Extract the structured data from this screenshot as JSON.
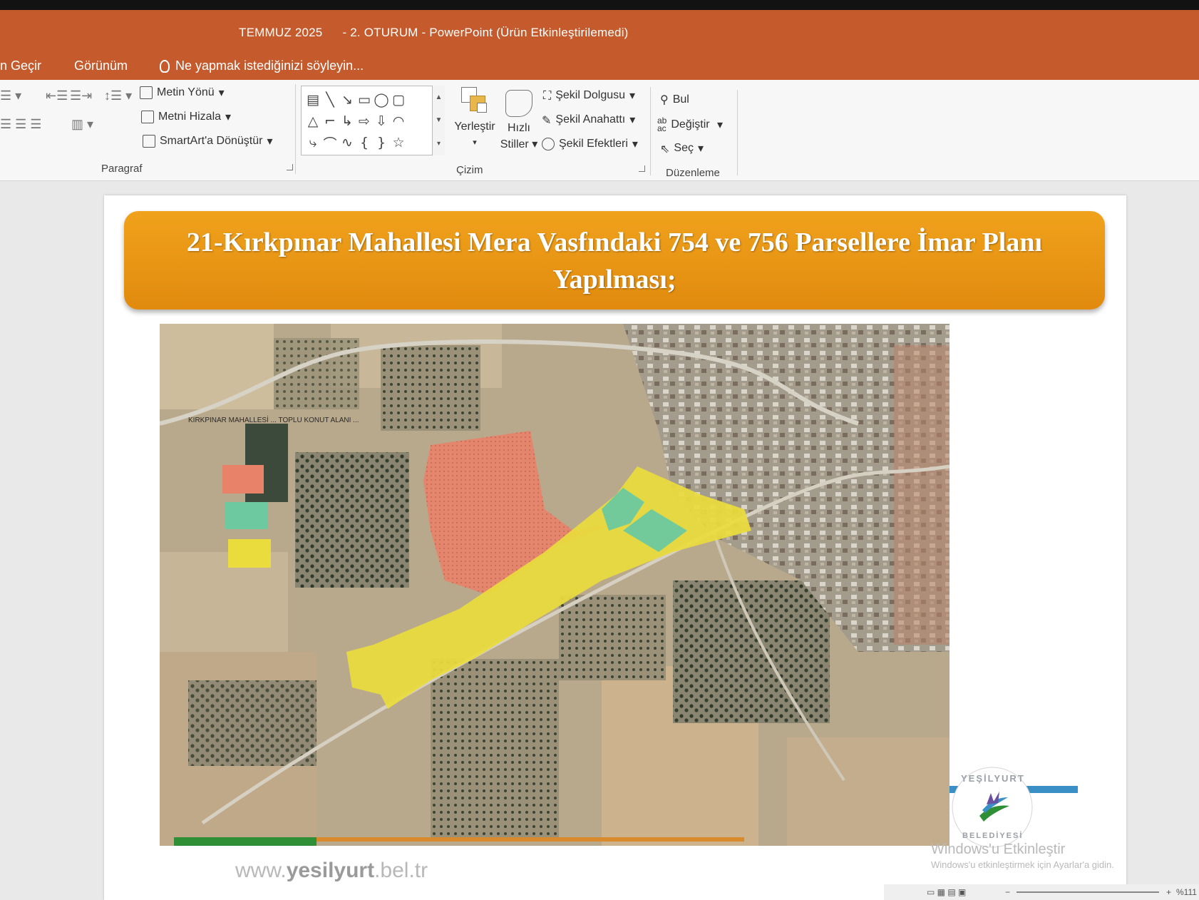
{
  "window": {
    "doc_part1": "TEMMUZ 2025",
    "doc_part2": "- 2. OTURUM - PowerPoint (Ürün Etkinleştirilemedi)"
  },
  "tabs": {
    "partial": "n Geçir",
    "view": "Görünüm",
    "tell_me": "Ne yapmak istediğinizi söyleyin..."
  },
  "ribbon": {
    "paragraph": {
      "label": "Paragraf",
      "text_direction": "Metin Yönü",
      "align_text": "Metni Hizala",
      "smartart": "SmartArt'a Dönüştür"
    },
    "drawing": {
      "label": "Çizim",
      "arrange": "Yerleştir",
      "quick_styles_1": "Hızlı",
      "quick_styles_2": "Stiller",
      "shape_fill": "Şekil Dolgusu",
      "shape_outline": "Şekil Anahattı",
      "shape_effects": "Şekil Efektleri"
    },
    "editing": {
      "label": "Düzenleme",
      "find": "Bul",
      "replace": "Değiştir",
      "select": "Seç"
    }
  },
  "slide": {
    "title_line1": "21-Kırkpınar Mahallesi Mera Vasfındaki 754 ve 756 Parsellere İmar Planı",
    "title_line2": "Yapılması;",
    "map_caption": "KIRKPINAR MAHALLESİ ... TOPLU KONUT ALANI ...",
    "legend": [
      {
        "color": "#e8836a"
      },
      {
        "color": "#6cc9a0"
      },
      {
        "color": "#e9dc3c"
      }
    ],
    "logo_top": "YEŞİLYURT",
    "logo_bottom": "BELEDİYESİ",
    "website_prefix": "www.",
    "website_brand": "yesilyurt",
    "website_suffix": ".bel.tr"
  },
  "watermark": {
    "line1": "Windows'u Etkinleştir",
    "line2": "Windows'u etkinleştirmek için Ayarlar'a gidin."
  },
  "status": {
    "zoom": "%111"
  },
  "colors": {
    "accent": "#c55a2d",
    "banner": "#e99515",
    "zone_orange": "#e8836a",
    "zone_green": "#6cc9a0",
    "zone_yellow": "#e9dc3c"
  }
}
